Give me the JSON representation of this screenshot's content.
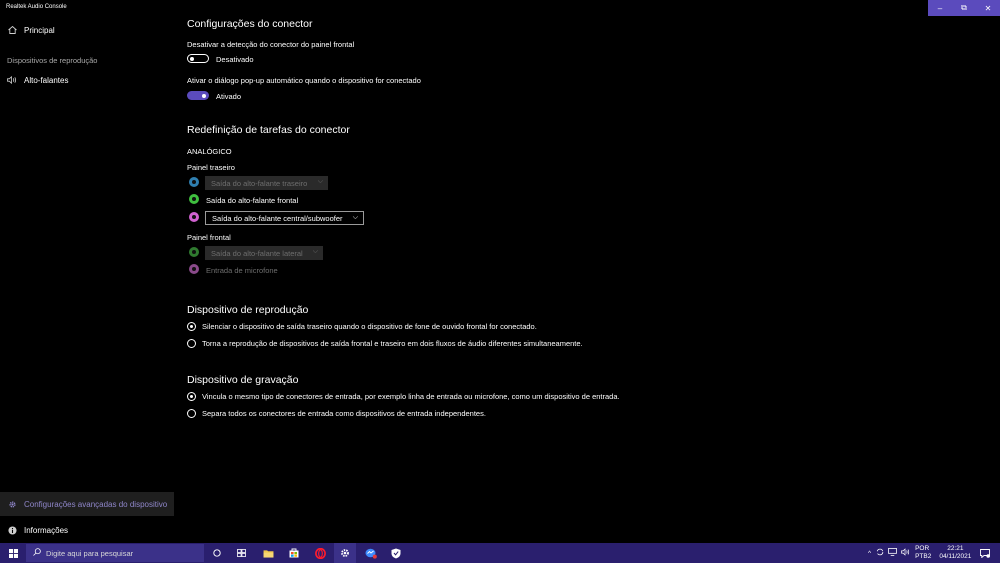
{
  "window": {
    "title": "Realtek Audio Console",
    "buttons": {
      "minimize": "–",
      "restore": "⧉",
      "close": "✕"
    }
  },
  "sidebar": {
    "home": {
      "icon": "home-icon",
      "label": "Principal"
    },
    "section_label": "Dispositivos de reprodução",
    "speakers": {
      "icon": "speaker-icon",
      "label": "Alto-falantes"
    },
    "advanced": {
      "icon": "gear-icon",
      "label": "Configurações avançadas do dispositivo"
    },
    "info": {
      "icon": "info-icon",
      "label": "Informações"
    }
  },
  "connector_settings": {
    "title": "Configurações do conector",
    "front_detection": {
      "label": "Desativar a detecção do conector do painel frontal",
      "state": "Desativado",
      "on": false
    },
    "auto_popup": {
      "label": "Ativar o diálogo pop-up automático quando o dispositivo for conectado",
      "state": "Ativado",
      "on": true
    }
  },
  "retasking": {
    "title": "Redefinição de tarefas do conector",
    "analog_label": "ANALÓGICO",
    "rear_panel": {
      "label": "Painel traseiro",
      "jacks": [
        {
          "color": "#2f7fb0",
          "value": "Saída do alto-falante traseiro",
          "enabled": false
        },
        {
          "color": "#3fbf3f",
          "value": "Saída do alto-falante frontal",
          "enabled": true
        },
        {
          "color": "#d062d0",
          "value": "Saída do alto-falante central/subwoofer",
          "enabled": true
        }
      ]
    },
    "front_panel": {
      "label": "Painel frontal",
      "jacks": [
        {
          "color": "#2f7a2f",
          "value": "Saída do alto-falante lateral",
          "enabled": false
        },
        {
          "color": "#8a4a8a",
          "value": "Entrada de microfone",
          "enabled": false
        }
      ]
    }
  },
  "playback_device": {
    "title": "Dispositivo de reprodução",
    "options": [
      {
        "label": "Silenciar o dispositivo de saída traseiro quando o dispositivo de fone de ouvido frontal for conectado.",
        "checked": true
      },
      {
        "label": "Torna a reprodução de dispositivos de saída frontal e traseiro em dois fluxos de áudio diferentes simultaneamente.",
        "checked": false
      }
    ]
  },
  "recording_device": {
    "title": "Dispositivo de gravação",
    "options": [
      {
        "label": "Vincula o mesmo tipo de conectores de entrada, por exemplo linha de entrada ou microfone, como um dispositivo de entrada.",
        "checked": true
      },
      {
        "label": "Separa todos os conectores de entrada como dispositivos de entrada independentes.",
        "checked": false
      }
    ]
  },
  "taskbar": {
    "search_placeholder": "Digite aqui para pesquisar",
    "language_top": "POR",
    "language_bottom": "PTB2",
    "time": "22:21",
    "date": "04/11/2021"
  },
  "colors": {
    "accent": "#5b4bbd",
    "taskbar": "#2a1f6e"
  }
}
